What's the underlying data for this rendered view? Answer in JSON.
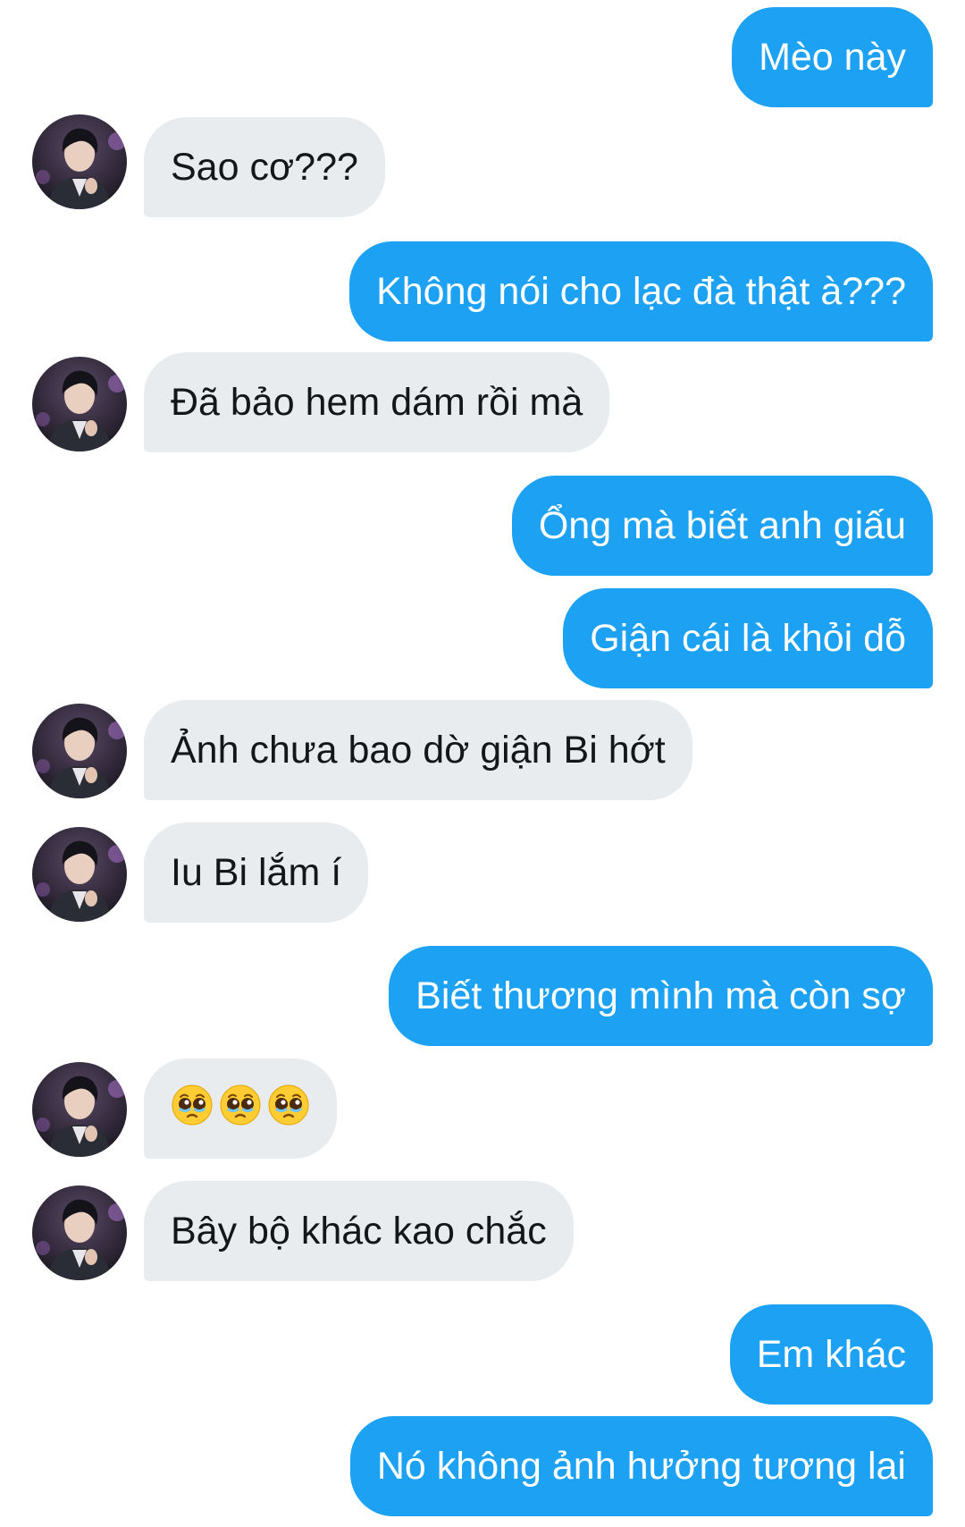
{
  "conversation": {
    "messages": [
      {
        "id": "m1",
        "side": "out",
        "text": "Mèo này"
      },
      {
        "id": "m2",
        "side": "in",
        "text": "Sao cơ???"
      },
      {
        "id": "m3",
        "side": "out",
        "text": "Không nói cho lạc đà thật à???"
      },
      {
        "id": "m4",
        "side": "in",
        "text": "Đã bảo hem dám rồi mà"
      },
      {
        "id": "m5",
        "side": "out",
        "text": "Ổng mà biết anh giấu"
      },
      {
        "id": "m6",
        "side": "out",
        "text": "Giận cái là khỏi dỗ"
      },
      {
        "id": "m7",
        "side": "in",
        "text": "Ảnh chưa bao dờ giận Bi hớt"
      },
      {
        "id": "m8",
        "side": "in",
        "text": "Iu Bi lắm í"
      },
      {
        "id": "m9",
        "side": "out",
        "text": "Biết thương mình mà còn sợ"
      },
      {
        "id": "m10",
        "side": "in",
        "emoji": [
          "pleading-face",
          "pleading-face",
          "pleading-face"
        ]
      },
      {
        "id": "m11",
        "side": "in",
        "text": "Bây bộ khác kao chắc"
      },
      {
        "id": "m12",
        "side": "out",
        "text": "Em khác"
      },
      {
        "id": "m13",
        "side": "out",
        "text": "Nó không ảnh hưởng tương lai"
      }
    ]
  },
  "colors": {
    "outgoing_bubble": "#1da1f2",
    "incoming_bubble": "#e8ecef",
    "outgoing_text": "#ffffff",
    "incoming_text": "#14171a"
  },
  "icons": {
    "avatar": "user-avatar-photo",
    "emoji": "pleading-face"
  }
}
